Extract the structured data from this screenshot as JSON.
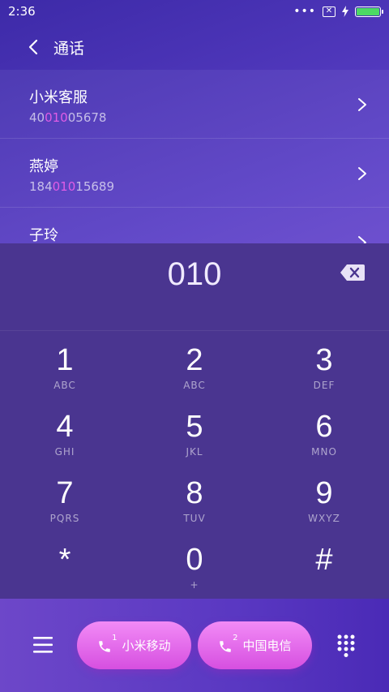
{
  "status": {
    "time": "2:36",
    "dots": "•••"
  },
  "header": {
    "title": "通话"
  },
  "contacts": [
    {
      "name": "小米客服",
      "num_pre": "40",
      "num_hl": "010",
      "num_post": "05678"
    },
    {
      "name": "燕婷",
      "num_pre": "184",
      "num_hl": "010",
      "num_post": "15689"
    },
    {
      "name": "子玲",
      "num_pre": "",
      "num_hl": "",
      "num_post": ""
    }
  ],
  "dialer": {
    "dialed": "010"
  },
  "keys": [
    {
      "digit": "1",
      "letters": "ABC"
    },
    {
      "digit": "2",
      "letters": "ABC"
    },
    {
      "digit": "3",
      "letters": "DEF"
    },
    {
      "digit": "4",
      "letters": "GHI"
    },
    {
      "digit": "5",
      "letters": "JKL"
    },
    {
      "digit": "6",
      "letters": "MNO"
    },
    {
      "digit": "7",
      "letters": "PQRS"
    },
    {
      "digit": "8",
      "letters": "TUV"
    },
    {
      "digit": "9",
      "letters": "WXYZ"
    },
    {
      "digit": "*",
      "letters": ""
    },
    {
      "digit": "0",
      "letters": "+"
    },
    {
      "digit": "#",
      "letters": ""
    }
  ],
  "bottom": {
    "sim1_label": "小米移动",
    "sim1_num": "1",
    "sim2_label": "中国电信",
    "sim2_num": "2"
  },
  "colors": {
    "highlight": "#e05ce6",
    "call_button": "#e06ae8",
    "battery": "#4cd964"
  }
}
